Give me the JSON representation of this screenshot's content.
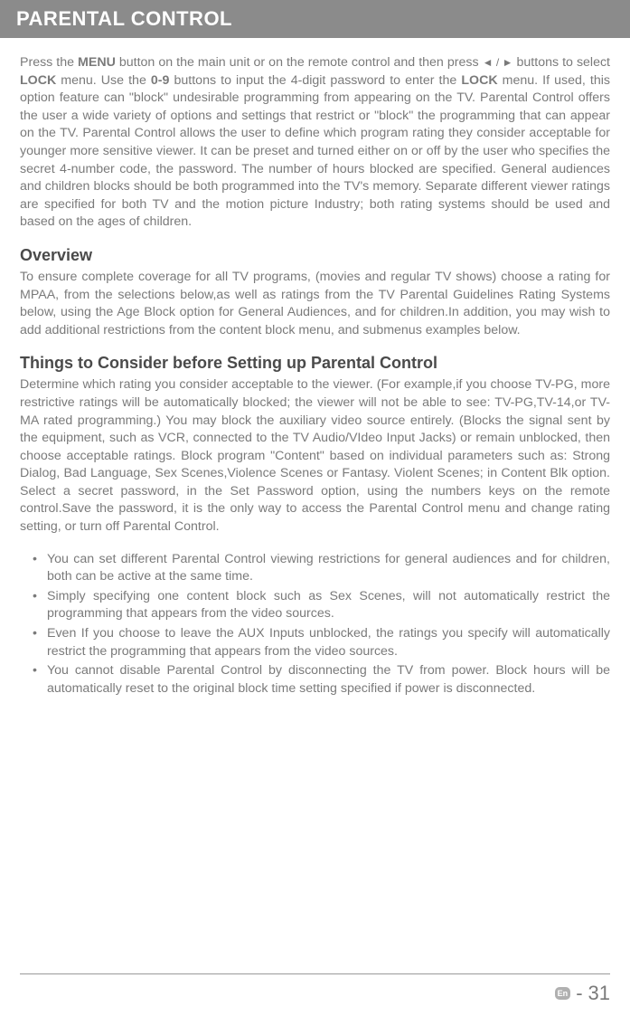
{
  "header": "PARENTAL CONTROL",
  "intro": {
    "p1": "Press the ",
    "p2": "MENU",
    "p3": " button on the main unit or on the remote control and then press ",
    "p4": "◄ / ►",
    "p5": " buttons to select ",
    "p6": "LOCK",
    "p7": " menu. Use the ",
    "p8": "0-9",
    "p9": " buttons to input the 4-digit password to enter the ",
    "p10": "LOCK",
    "p11": " menu. If used, this option feature  can \"block\" undesirable programming from appearing on the TV. Parental Control offers the user a wide  variety  of options and settings that restrict or \"block\" the programming that can appear on the TV. Parental Control allows the user to define which program rating they consider acceptable for younger more sensitive viewer. It can be preset and turned either on or off by the user who specifies the secret 4-number code, the password. The number of hours blocked are specified. General audiences and children blocks should be both programmed into the TV's memory. Separate different viewer ratings are specified for both TV and the motion picture Industry;  both rating systems should be used and based on the ages of children."
  },
  "overview": {
    "title": "Overview",
    "text": "To ensure complete coverage for all TV programs, (movies and regular TV shows) choose a rating for MPAA, from the selections below,as well as ratings from the TV Parental Guidelines Rating Systems below, using the Age Block option for General Audiences, and for children.In addition, you may wish to add additional restrictions from the content block menu, and submenus examples below."
  },
  "consider": {
    "title": "Things to Consider before Setting up Parental Control",
    "text": "Determine which rating you consider acceptable to the viewer. (For example,if you choose TV-PG, more restrictive ratings will be automatically blocked; the viewer will not be able to see: TV-PG,TV-14,or TV-MA rated programming.) You may block the auxiliary video source entirely. (Blocks the signal sent by the equipment, such as VCR, connected to the TV Audio/VIdeo Input Jacks) or remain unblocked, then choose acceptable ratings. Block program \"Content\" based on individual parameters such as: Strong Dialog, Bad Language, Sex Scenes,Violence Scenes or Fantasy. Violent Scenes; in Content Blk option. Select a secret password, in the Set Password option, using the numbers keys on the remote control.Save the password, it is the only way to access the Parental  Control menu and change rating setting, or turn off Parental Control."
  },
  "bullets": [
    "You can set different Parental Control viewing restrictions for general audiences and for children, both can be active at the same time.",
    "Simply specifying one content block such as Sex Scenes, will not automatically restrict the programming that appears from the video sources.",
    "Even If you choose to leave the AUX Inputs unblocked, the ratings you specify will automatically restrict the programming that appears from the video sources.",
    "You cannot disable Parental Control by disconnecting the TV from power. Block hours will be automatically reset to the original block time setting specified if power is disconnected."
  ],
  "footer": {
    "badge": "En",
    "dash": "-",
    "page": "31"
  }
}
